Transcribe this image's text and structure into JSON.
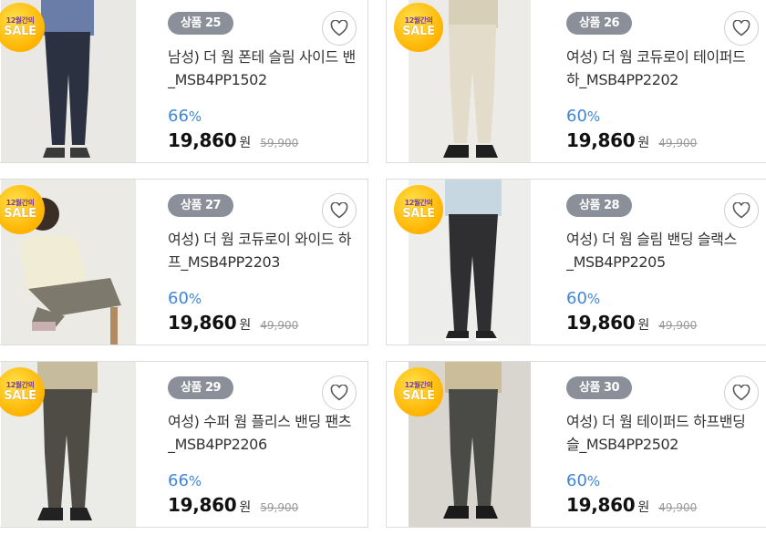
{
  "sale_badge": {
    "line1": "12월간의",
    "line2": "SALE"
  },
  "currency": "원",
  "products": [
    {
      "badge": "상품 25",
      "title": "남성) 더 웜 폰테 슬림 사이드 밴_MSB4PP1502",
      "discount": "66",
      "pct": "%",
      "price": "19,860",
      "original": "59,900",
      "image": "mens-slim-pants-navy",
      "colors": {
        "pants": "#2b3140",
        "top": "#6a7da8",
        "bg": "#e9e8e4"
      }
    },
    {
      "badge": "상품 26",
      "title": "여성) 더 웜 코듀로이 테이퍼드 하_MSB4PP2202",
      "discount": "60",
      "pct": "%",
      "price": "19,860",
      "original": "49,900",
      "image": "womens-corduroy-tapered-beige",
      "colors": {
        "pants": "#e3dccb",
        "top": "#d8cfb8",
        "bg": "#ecebe7"
      }
    },
    {
      "badge": "상품 27",
      "title": "여성) 더 웜 코듀로이 와이드 하프_MSB4PP2203",
      "discount": "60",
      "pct": "%",
      "price": "19,860",
      "original": "49,900",
      "image": "womens-corduroy-wide-khaki",
      "colors": {
        "pants": "#7d7a6d",
        "top": "#f1ecd6",
        "bg": "#eceae5"
      }
    },
    {
      "badge": "상품 28",
      "title": "여성) 더 웜 슬림 밴딩 슬랙스_MSB4PP2205",
      "discount": "60",
      "pct": "%",
      "price": "19,860",
      "original": "49,900",
      "image": "womens-slim-banding-slacks-charcoal",
      "colors": {
        "pants": "#2f2f31",
        "top": "#c7d7e2",
        "bg": "#ededeb"
      }
    },
    {
      "badge": "상품 29",
      "title": "여성) 수퍼 웜 플리스 밴딩 팬츠_MSB4PP2206",
      "discount": "66",
      "pct": "%",
      "price": "19,860",
      "original": "59,900",
      "image": "womens-fleece-banding-pants-olive",
      "colors": {
        "pants": "#4f4c45",
        "top": "#c6bb9c",
        "bg": "#ebebe8"
      }
    },
    {
      "badge": "상품 30",
      "title": "여성) 더 웜 테이퍼드 하프밴딩 슬_MSB4PP2502",
      "discount": "60",
      "pct": "%",
      "price": "19,860",
      "original": "49,900",
      "image": "womens-tapered-half-banding-gray",
      "colors": {
        "pants": "#4a4a47",
        "top": "#cbbd9a",
        "bg": "#d9d6cf"
      }
    }
  ]
}
